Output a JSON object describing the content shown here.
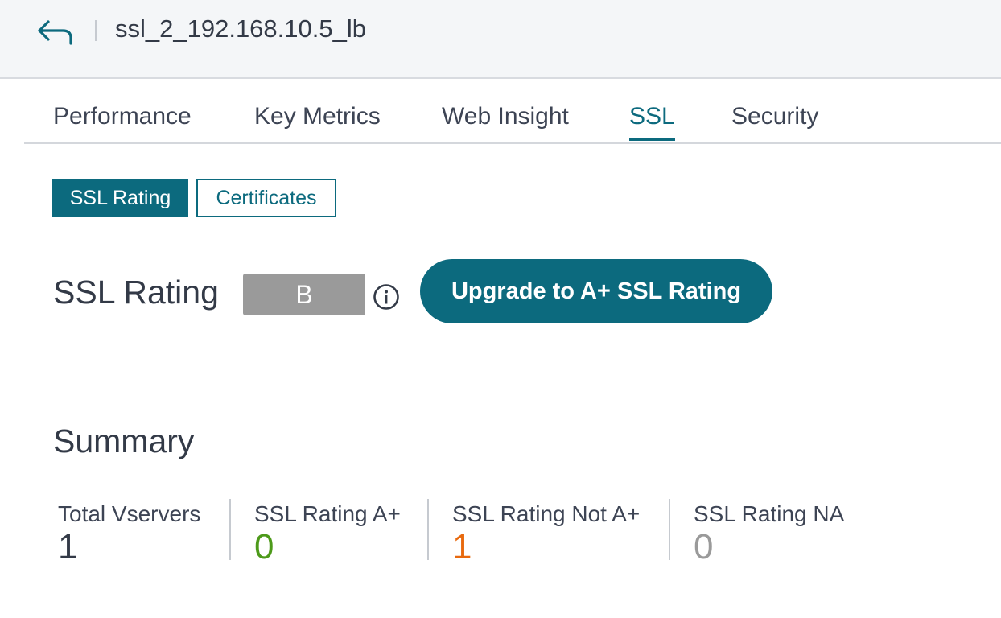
{
  "header": {
    "title": "ssl_2_192.168.10.5_lb",
    "back_icon": "back-arrow-icon"
  },
  "tabs": [
    {
      "label": "Performance",
      "active": false
    },
    {
      "label": "Key Metrics",
      "active": false
    },
    {
      "label": "Web Insight",
      "active": false
    },
    {
      "label": "SSL",
      "active": true
    },
    {
      "label": "Security",
      "active": false
    }
  ],
  "subtabs": [
    {
      "label": "SSL Rating",
      "active": true
    },
    {
      "label": "Certificates",
      "active": false
    }
  ],
  "rating": {
    "heading": "SSL Rating",
    "grade": "B",
    "info_icon": "info-icon",
    "upgrade_label": "Upgrade to A+ SSL Rating"
  },
  "summary": {
    "heading": "Summary",
    "stats": [
      {
        "label": "Total Vservers",
        "value": "1",
        "color": "#333a47"
      },
      {
        "label": "SSL Rating A+",
        "value": "0",
        "color": "#4d9a1a"
      },
      {
        "label": "SSL Rating Not A+",
        "value": "1",
        "color": "#e8690e"
      },
      {
        "label": "SSL Rating NA",
        "value": "0",
        "color": "#9a9a9a"
      }
    ]
  },
  "colors": {
    "accent": "#0c6a7e",
    "header_bg": "#f4f6f8",
    "grade_badge": "#9a9a9a"
  }
}
